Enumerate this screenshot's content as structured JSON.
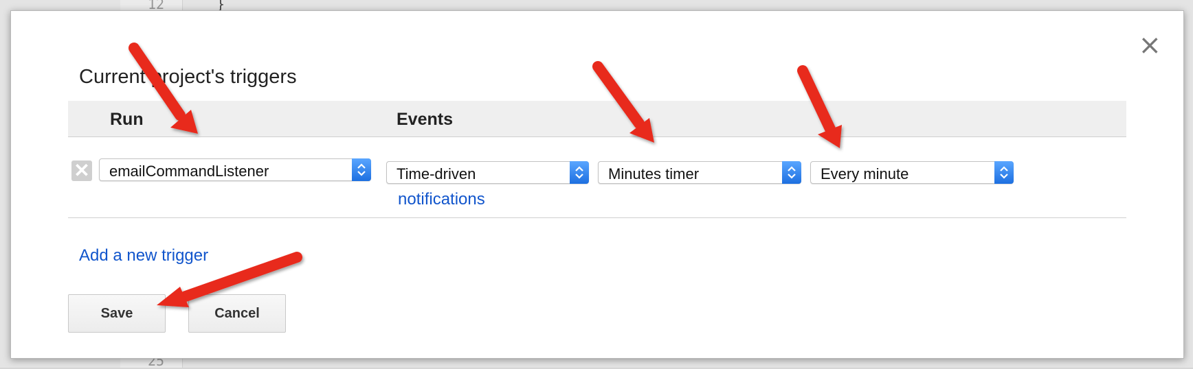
{
  "background": {
    "top_line_number": "12",
    "top_code": "}",
    "bottom_line_number": "25"
  },
  "dialog": {
    "title": "Current project's triggers",
    "close_label": "×",
    "columns": {
      "run": "Run",
      "events": "Events"
    },
    "trigger": {
      "remove_label": "✕",
      "function": "emailCommandListener",
      "event_source": "Time-driven",
      "timer_type": "Minutes timer",
      "interval": "Every minute",
      "notifications_link": "notifications"
    },
    "add_trigger_link": "Add a new trigger",
    "save_label": "Save",
    "cancel_label": "Cancel"
  },
  "colors": {
    "link": "#1155cc",
    "select_knob": "#2f7ff0",
    "annotation_arrow": "#e8291c"
  }
}
